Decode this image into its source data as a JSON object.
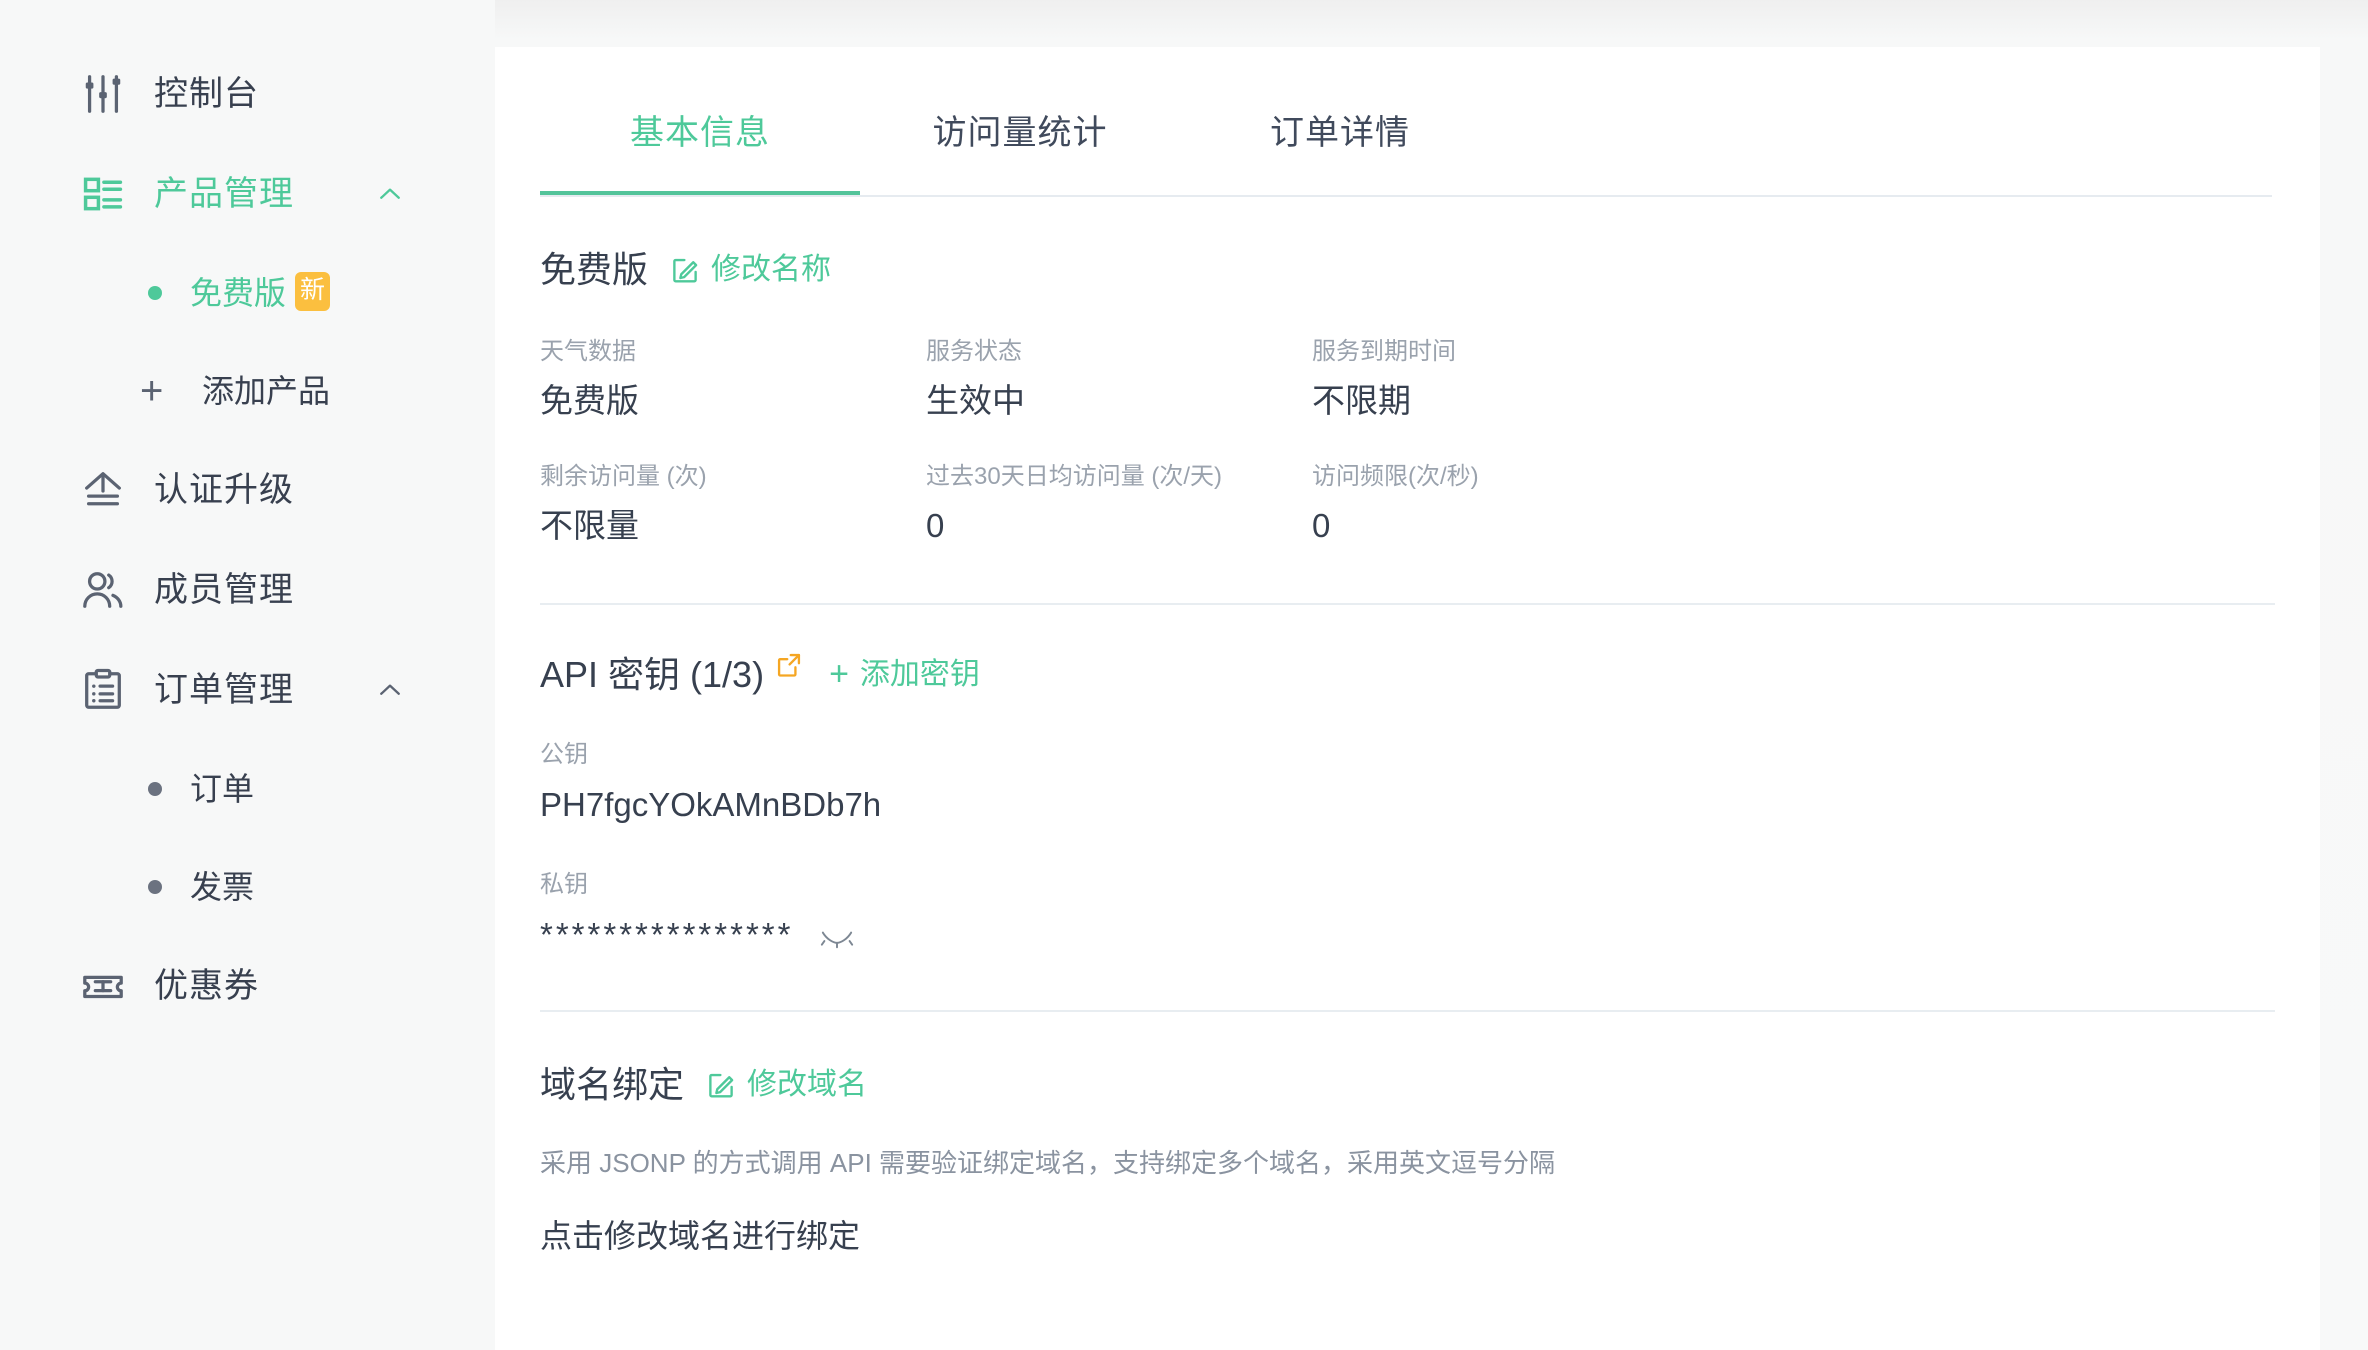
{
  "sidebar": {
    "items": [
      {
        "label": "控制台",
        "icon": "sliders-icon"
      },
      {
        "label": "产品管理",
        "icon": "grid-list-icon",
        "chevron": "chevron-up-icon"
      },
      {
        "label": "认证升级",
        "icon": "upgrade-arrow-icon"
      },
      {
        "label": "成员管理",
        "icon": "users-icon"
      },
      {
        "label": "订单管理",
        "icon": "clipboard-icon",
        "chevron": "chevron-up-icon"
      },
      {
        "label": "优惠券",
        "icon": "coupon-ticket-icon"
      }
    ],
    "product_children": [
      {
        "label": "免费版",
        "badge": "新"
      }
    ],
    "add_product_label": "添加产品",
    "add_product_icon": "plus-icon",
    "order_children": [
      {
        "label": "订单"
      },
      {
        "label": "发票"
      }
    ]
  },
  "tabs": [
    {
      "label": "基本信息",
      "active": true
    },
    {
      "label": "访问量统计",
      "active": false
    },
    {
      "label": "订单详情",
      "active": false
    }
  ],
  "product": {
    "name": "免费版",
    "rename_label": "修改名称",
    "rename_icon": "edit-square-icon",
    "fields": [
      {
        "label": "天气数据",
        "value": "免费版"
      },
      {
        "label": "服务状态",
        "value": "生效中"
      },
      {
        "label": "服务到期时间",
        "value": "不限期"
      },
      {
        "label": "剩余访问量 (次)",
        "value": "不限量"
      },
      {
        "label": "过去30天日均访问量 (次/天)",
        "value": "0"
      },
      {
        "label": "访问频限(次/秒)",
        "value": "0"
      }
    ]
  },
  "api_keys": {
    "title": "API 密钥 (1/3)",
    "external_icon": "external-link-icon",
    "add_label": "添加密钥",
    "add_icon": "plus-icon",
    "public_label": "公钥",
    "public_value": "PH7fgcYOkAMnBDb7h",
    "private_label": "私钥",
    "private_masked": "****************",
    "private_toggle_icon": "eye-closed-icon"
  },
  "domain": {
    "title": "域名绑定",
    "edit_label": "修改域名",
    "edit_icon": "edit-square-icon",
    "description": "采用 JSONP 的方式调用 API 需要验证绑定域名，支持绑定多个域名，采用英文逗号分隔",
    "value": "点击修改域名进行绑定"
  },
  "colors": {
    "accent_green": "#4ec99a",
    "badge_orange": "#fbbf3f",
    "text_dark": "#37404f",
    "text_muted": "#9aa2ad",
    "divider": "#e8edf1",
    "panel_bg": "#ffffff",
    "page_bg": "#f7f8f8"
  }
}
